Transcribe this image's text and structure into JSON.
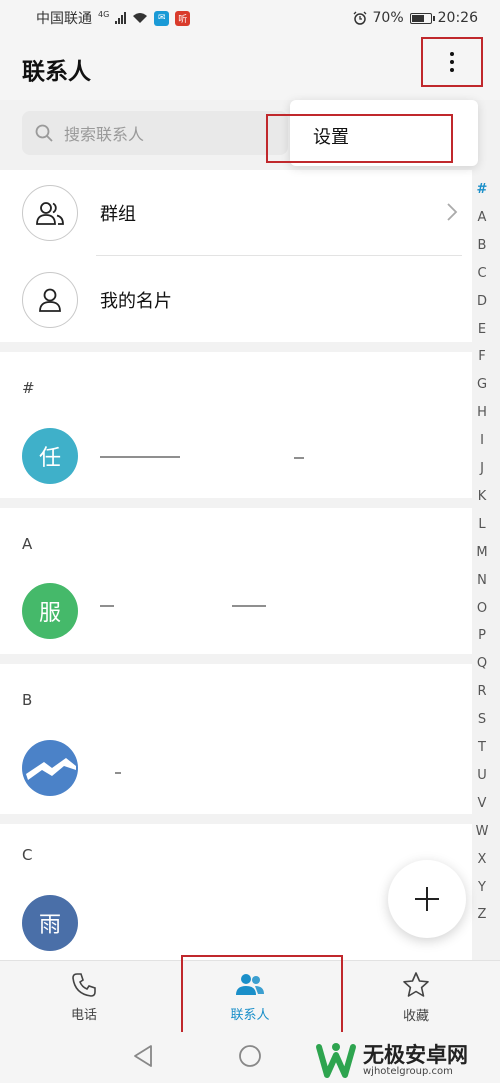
{
  "status_bar": {
    "carrier": "中国联通",
    "network": "4G",
    "battery": "70%",
    "battery_level": 0.7,
    "time": "20:26"
  },
  "header": {
    "title": "联系人"
  },
  "search": {
    "placeholder": "搜索联系人"
  },
  "menu": {
    "settings_label": "设置"
  },
  "quick_items": {
    "groups_label": "群组",
    "my_card_label": "我的名片"
  },
  "sections": [
    {
      "letter": "#",
      "avatar_char": "任",
      "avatar_color": "#3fb0c9"
    },
    {
      "letter": "A",
      "avatar_char": "服",
      "avatar_color": "#45b96a"
    },
    {
      "letter": "B",
      "avatar_char": "",
      "avatar_color": "#4b82c8"
    },
    {
      "letter": "C",
      "avatar_char": "雨",
      "avatar_color": "#4a6fa8"
    }
  ],
  "alpha_index": [
    "#",
    "A",
    "B",
    "C",
    "D",
    "E",
    "F",
    "G",
    "H",
    "I",
    "J",
    "K",
    "L",
    "M",
    "N",
    "O",
    "P",
    "Q",
    "R",
    "S",
    "T",
    "U",
    "V",
    "W",
    "X",
    "Y",
    "Z"
  ],
  "bottom_nav": {
    "phone_label": "电话",
    "contacts_label": "联系人",
    "favorites_label": "收藏"
  },
  "watermark": {
    "title": "无极安卓网",
    "url": "wjhotelgroup.com"
  },
  "colors": {
    "accent": "#1a8fc9",
    "highlight_box": "#c0282c"
  }
}
